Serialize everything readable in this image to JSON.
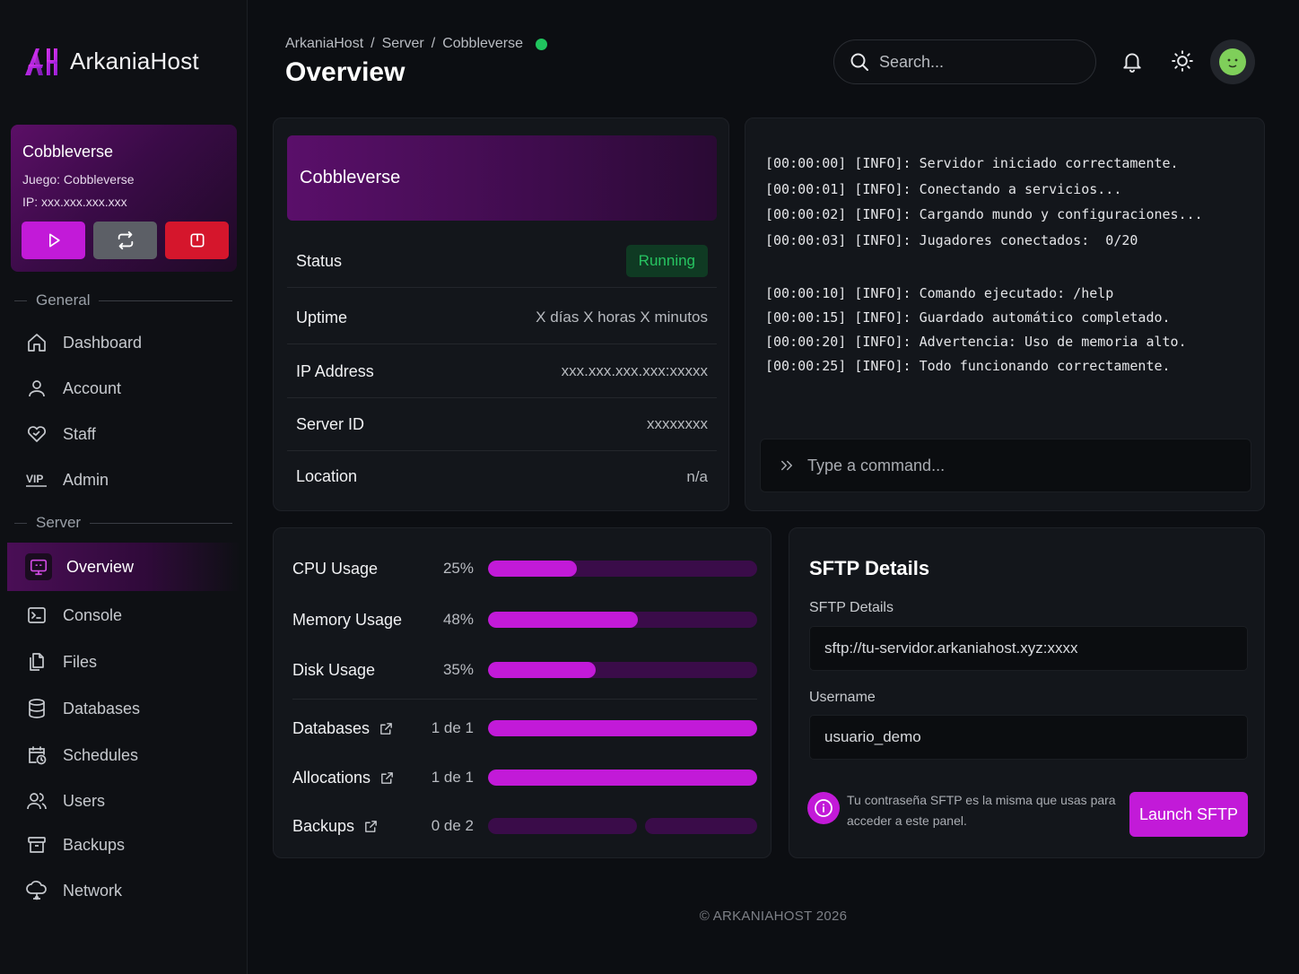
{
  "brand": {
    "name": "ArkaniaHost",
    "accent": "#c21ad8",
    "logo_icon": "arkaniahost-logo-icon"
  },
  "server_card": {
    "name": "Cobbleverse",
    "game": "Juego: Cobbleverse",
    "ip": "IP: xxx.xxx.xxx.xxx",
    "buttons": {
      "start": "play-icon",
      "restart": "restart-icon",
      "stop": "power-icon"
    }
  },
  "sidebar": {
    "sections": {
      "general": "General",
      "server": "Server"
    },
    "general_items": [
      {
        "label": "Dashboard",
        "icon": "home-icon"
      },
      {
        "label": "Account",
        "icon": "user-icon"
      },
      {
        "label": "Staff",
        "icon": "heart-handshake-icon"
      },
      {
        "label": "Admin",
        "icon": "vip-icon"
      }
    ],
    "server_items": [
      {
        "label": "Overview",
        "icon": "monitor-icon",
        "active": true
      },
      {
        "label": "Console",
        "icon": "terminal-icon"
      },
      {
        "label": "Files",
        "icon": "files-icon"
      },
      {
        "label": "Databases",
        "icon": "database-icon"
      },
      {
        "label": "Schedules",
        "icon": "calendar-clock-icon"
      },
      {
        "label": "Users",
        "icon": "users-icon"
      },
      {
        "label": "Backups",
        "icon": "archive-icon"
      },
      {
        "label": "Network",
        "icon": "cloud-network-icon"
      }
    ]
  },
  "header": {
    "breadcrumb": [
      "ArkaniaHost",
      "Server",
      "Cobbleverse"
    ],
    "separator": "/",
    "status_color": "#20c55e",
    "title": "Overview",
    "search_placeholder": "Search..."
  },
  "info_card": {
    "title": "Cobbleverse",
    "rows": {
      "status": {
        "label": "Status",
        "value": "Running"
      },
      "uptime": {
        "label": "Uptime",
        "value": "X días X horas X minutos"
      },
      "ip": {
        "label": "IP Address",
        "value": "xxx.xxx.xxx.xxx:xxxxx"
      },
      "server_id": {
        "label": "Server ID",
        "value": "xxxxxxxx"
      },
      "location": {
        "label": "Location",
        "value": "n/a"
      }
    }
  },
  "console": {
    "lines": [
      "[00:00:00] [INFO]: Servidor iniciado correctamente.",
      "[00:00:01] [INFO]: Conectando a servicios...",
      "[00:00:02] [INFO]: Cargando mundo y configuraciones...",
      "[00:00:03] [INFO]: Jugadores conectados:  0/20",
      "",
      "[00:00:10] [INFO]: Comando ejecutado: /help",
      "[00:00:15] [INFO]: Guardado automático completado.",
      "[00:00:20] [INFO]: Advertencia: Uso de memoria alto.",
      "[00:00:25] [INFO]: Todo funcionando correctamente."
    ],
    "command_placeholder": "Type a command..."
  },
  "usage": {
    "cpu": {
      "label": "CPU Usage",
      "value": "25%",
      "fill": 0.33
    },
    "memory": {
      "label": "Memory Usage",
      "value": "48%",
      "fill": 0.555
    },
    "disk": {
      "label": "Disk Usage",
      "value": "35%",
      "fill": 0.4
    },
    "databases": {
      "label": "Databases",
      "value": "1 de 1",
      "fill": 1
    },
    "allocations": {
      "label": "Allocations",
      "value": "1 de 1",
      "fill": 1
    },
    "backups": {
      "label": "Backups",
      "value": "0 de 2",
      "fill": 0
    }
  },
  "sftp": {
    "title": "SFTP Details",
    "address_label": "SFTP Details",
    "address_value": "sftp://tu-servidor.arkaniahost.xyz:xxxx",
    "username_label": "Username",
    "username_value": "usuario_demo",
    "note": "Tu contraseña SFTP es la misma que usas para acceder a este panel.",
    "launch_label": "Launch SFTP"
  },
  "footer": "© ARKANIAHOST 2026"
}
